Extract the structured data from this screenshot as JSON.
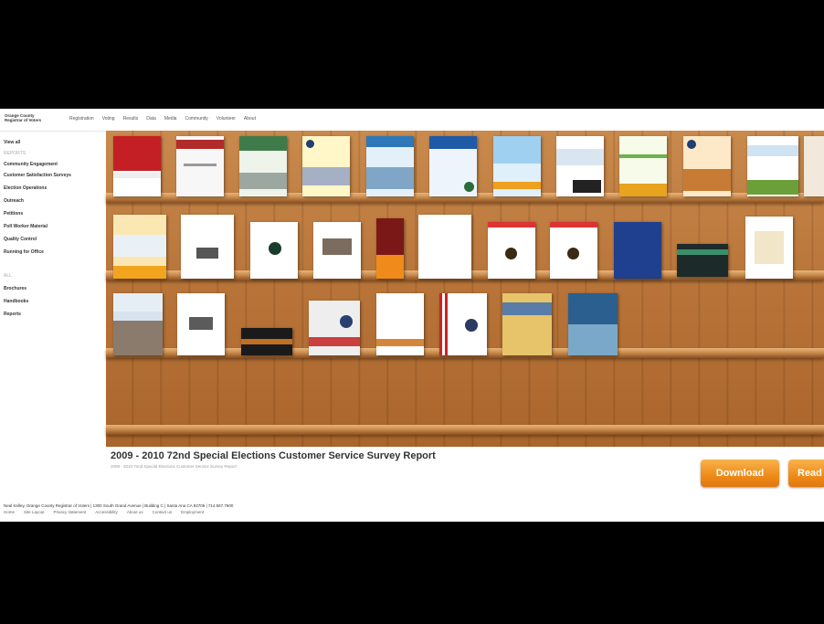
{
  "header": {
    "logo_line1": "Orange County",
    "logo_line2": "Registrar of Voters",
    "nav": [
      "Registration",
      "Voting",
      "Results",
      "Data",
      "Media",
      "Community",
      "Volunteer",
      "About"
    ]
  },
  "sidebar": {
    "items": [
      {
        "label": "View all",
        "muted": false
      },
      {
        "label": "REPORTS",
        "muted": true
      },
      {
        "label": "Community Engagement",
        "muted": false
      },
      {
        "label": "Customer Satisfaction Surveys",
        "muted": false
      },
      {
        "label": "Election Operations",
        "muted": false
      },
      {
        "label": "Outreach",
        "muted": false
      },
      {
        "label": "Petitions",
        "muted": false
      },
      {
        "label": "Poll Worker Material",
        "muted": false
      },
      {
        "label": "Quality Control",
        "muted": false
      },
      {
        "label": "Running for Office",
        "muted": false
      },
      {
        "label": "",
        "muted": true
      },
      {
        "label": "ALL",
        "muted": true
      },
      {
        "label": "Brochures",
        "muted": false
      },
      {
        "label": "Handbooks",
        "muted": false
      },
      {
        "label": "Reports",
        "muted": false
      }
    ]
  },
  "selected_report": {
    "title": "2009 - 2010 72nd Special Elections Customer Service Survey Report",
    "subtitle": "2009 - 2010 72nd Special Elections Customer Service Survey Report"
  },
  "actions": {
    "download_label": "Download",
    "read_label": "Read"
  },
  "footer": {
    "line1": "Neal Kelley, Orange County Registrar of Voters | 1300 South Grand Avenue | Building C | Santa Ana CA 92705 | 714.567.7600",
    "links": [
      "Home",
      "Site Layout",
      "Privacy statement",
      "Accessibility",
      "About us",
      "Contact us",
      "Employment"
    ]
  },
  "colors": {
    "shelf_wood": "#b87438",
    "button_orange": "#ee8a17"
  }
}
